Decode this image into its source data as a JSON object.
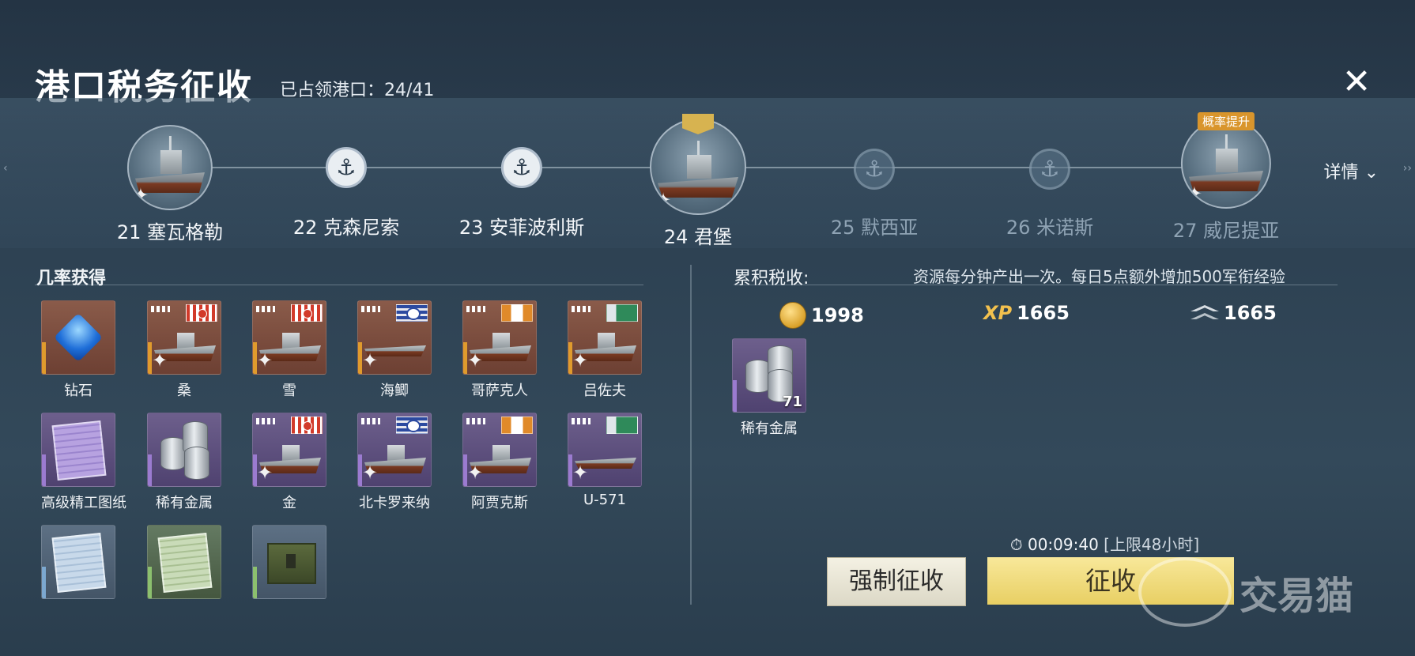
{
  "header": {
    "title": "港口税务征收",
    "ports_label": "已占领港口：24/41",
    "close_icon": "close-icon"
  },
  "route": {
    "nodes": [
      {
        "label": "21 塞瓦格勒",
        "type": "ship",
        "state": "captured"
      },
      {
        "label": "22 克森尼索",
        "type": "anchor",
        "state": "captured"
      },
      {
        "label": "23 安菲波利斯",
        "type": "anchor",
        "state": "captured"
      },
      {
        "label": "24 君堡",
        "type": "ship",
        "state": "current"
      },
      {
        "label": "25 默西亚",
        "type": "anchor",
        "state": "locked"
      },
      {
        "label": "26 米诺斯",
        "type": "anchor",
        "state": "locked"
      },
      {
        "label": "27 威尼提亚",
        "type": "ship",
        "state": "locked"
      }
    ],
    "probability_tag": "概率提升",
    "details_label": "详情",
    "details_icon": "chevron-down-icon"
  },
  "drops": {
    "title": "几率获得",
    "items": [
      {
        "label": "钻石",
        "kind": "gem",
        "rarity": "orange"
      },
      {
        "label": "桑",
        "kind": "ship",
        "flag": "jp",
        "rarity": "orange"
      },
      {
        "label": "雪",
        "kind": "ship",
        "flag": "jp",
        "rarity": "orange"
      },
      {
        "label": "海鲫",
        "kind": "ship",
        "flag": "us",
        "rarity": "orange"
      },
      {
        "label": "哥萨克人",
        "kind": "ship",
        "flag": "fr",
        "rarity": "orange"
      },
      {
        "label": "吕佐夫",
        "kind": "ship",
        "flag": "uk",
        "rarity": "orange"
      },
      {
        "label": "高级精工图纸",
        "kind": "blueprint",
        "rarity": "purple"
      },
      {
        "label": "稀有金属",
        "kind": "metal",
        "rarity": "purple"
      },
      {
        "label": "金",
        "kind": "ship",
        "flag": "jp",
        "rarity": "purple"
      },
      {
        "label": "北卡罗来纳",
        "kind": "ship",
        "flag": "us",
        "rarity": "purple"
      },
      {
        "label": "阿贾克斯",
        "kind": "ship",
        "flag": "fr",
        "rarity": "purple"
      },
      {
        "label": "U-571",
        "kind": "ship",
        "flag": "uk",
        "rarity": "purple"
      },
      {
        "label": "",
        "kind": "blueprint",
        "rarity": "blue"
      },
      {
        "label": "",
        "kind": "blueprint",
        "rarity": "green"
      },
      {
        "label": "",
        "kind": "crate",
        "rarity": "gray"
      }
    ]
  },
  "accumulated": {
    "title": "累积税收:",
    "note": "资源每分钟产出一次。每日5点额外增加500军衔经验",
    "resources": [
      {
        "icon": "coin-icon",
        "value": "1998"
      },
      {
        "icon": "xp-icon",
        "icon_text": "XP",
        "value": "1665"
      },
      {
        "icon": "rank-icon",
        "value": "1665"
      }
    ],
    "reward": {
      "label": "稀有金属",
      "quantity": "71"
    }
  },
  "actions": {
    "timer": "00:09:40",
    "limit": "[上限48小时]",
    "force_label": "强制征收",
    "collect_label": "征收"
  },
  "watermark": {
    "text": "交易猫"
  }
}
